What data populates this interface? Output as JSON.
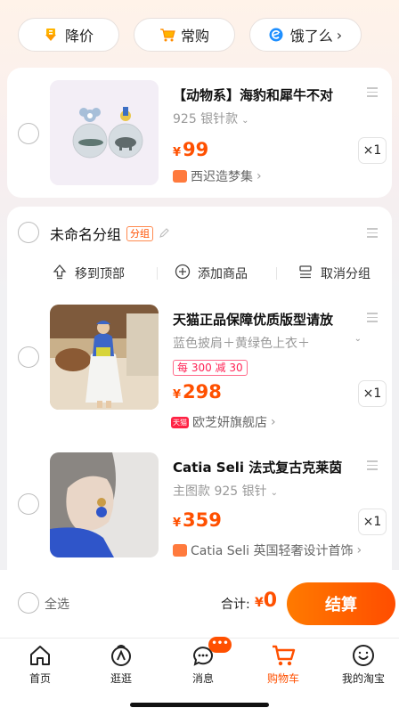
{
  "chips": [
    {
      "label": "降价",
      "icon": "price-down-icon"
    },
    {
      "label": "常购",
      "icon": "cart-icon"
    },
    {
      "label": "饿了么",
      "icon": "eleme-icon",
      "chevron": "›"
    }
  ],
  "item1": {
    "title": "【动物系】海豹和犀牛不对",
    "sku": "925 银针款",
    "currency": "¥",
    "price": "99",
    "qty": "×1",
    "shop": "西迟造梦集",
    "shop_chevron": "›"
  },
  "group": {
    "name": "未命名分组",
    "tag": "分组",
    "actions": {
      "top": "移到顶部",
      "add": "添加商品",
      "ungroup": "取消分组"
    }
  },
  "item2": {
    "title": "天猫正品保障优质版型请放",
    "sku": "蓝色披肩＋黄绿色上衣＋",
    "promo": "每 300 减 30",
    "currency": "¥",
    "price": "298",
    "qty": "×1",
    "shop_badge": "天猫",
    "shop": "欧芝妍旗舰店",
    "shop_chevron": "›"
  },
  "item3": {
    "title": "Catia Seli 法式复古克莱茵",
    "sku": "主图款 925 银针",
    "currency": "¥",
    "price": "359",
    "qty": "×1",
    "shop": "Catia Seli 英国轻奢设计首饰",
    "shop_chevron": "›"
  },
  "checkout": {
    "select_all": "全选",
    "total_label": "合计:",
    "currency": "¥",
    "total": "0",
    "button": "结算"
  },
  "tabs": [
    {
      "label": "首页",
      "icon": "home-icon"
    },
    {
      "label": "逛逛",
      "icon": "browse-icon"
    },
    {
      "label": "消息",
      "icon": "message-icon",
      "badge": "•••"
    },
    {
      "label": "购物车",
      "icon": "cart-icon",
      "active": true
    },
    {
      "label": "我的淘宝",
      "icon": "smile-icon"
    }
  ],
  "colors": {
    "accent": "#ff5000",
    "accent_gradient_start": "#ff7a00",
    "accent_gradient_end": "#ff4d00",
    "background": "#f1f1f3"
  }
}
